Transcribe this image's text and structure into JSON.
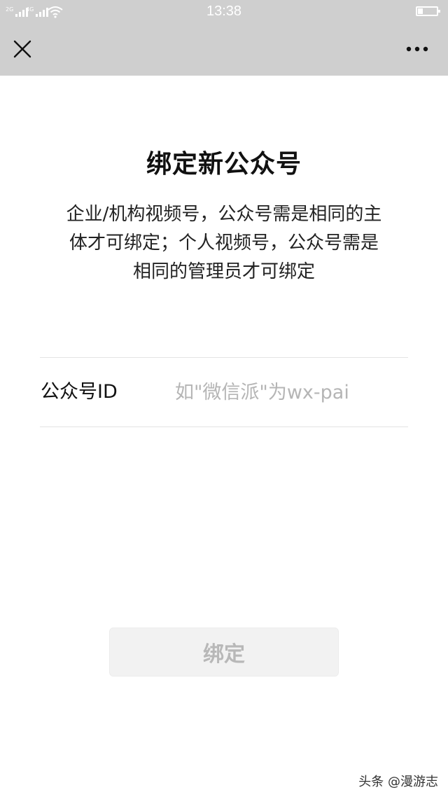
{
  "status_bar": {
    "time": "13:38",
    "signal_1_generation": "2G",
    "signal_2_generation": "4G",
    "wifi_icon": "wifi-icon",
    "battery_level": 0.25
  },
  "nav_bar": {
    "close_icon": "close-icon",
    "more_icon": "more-icon"
  },
  "main": {
    "title": "绑定新公众号",
    "description_lines": [
      "企业/机构视频号，公众号需是相同的主",
      "体才可绑定；个人视频号，公众号需是",
      "相同的管理员才可绑定"
    ],
    "field": {
      "label": "公众号ID",
      "value": "",
      "placeholder": "如\"微信派\"为wx-pai"
    },
    "bind_button_label": "绑定"
  },
  "watermark": "头条 @漫游志",
  "colors": {
    "header_bg": "#cfcfcf",
    "button_bg": "#f2f2f2",
    "button_text": "#b8b8b8",
    "placeholder": "#b5b5b5",
    "divider": "#e3e3e3"
  }
}
